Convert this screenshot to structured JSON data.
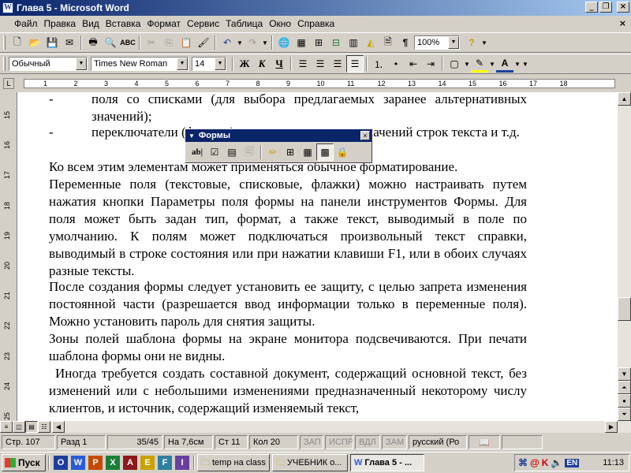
{
  "window": {
    "title": "Глава 5 - Microsoft Word",
    "app_icon": "W"
  },
  "menu": [
    "Файл",
    "Правка",
    "Вид",
    "Вставка",
    "Формат",
    "Сервис",
    "Таблица",
    "Окно",
    "Справка"
  ],
  "standard_toolbar": {
    "zoom": "100%",
    "icons": [
      "new-document-icon",
      "open-icon",
      "save-icon",
      "email-icon",
      "print-icon",
      "print-preview-icon",
      "spelling-icon",
      "cut-icon",
      "copy-icon",
      "paste-icon",
      "format-painter-icon",
      "undo-icon",
      "redo-icon",
      "hyperlink-icon",
      "tables-borders-icon",
      "insert-table-icon",
      "insert-excel-icon",
      "columns-icon",
      "drawing-icon",
      "document-map-icon",
      "show-formatting-icon",
      "help-icon"
    ]
  },
  "formatting_toolbar": {
    "style": "Обычный",
    "font": "Times New Roman",
    "size": "14",
    "bold": "Ж",
    "italic": "К",
    "underline": "Ч"
  },
  "ruler": {
    "numbers": [
      "1",
      "2",
      "3",
      "4",
      "5",
      "6",
      "7",
      "8",
      "9",
      "10",
      "11",
      "12",
      "13",
      "14",
      "15",
      "16",
      "17",
      "18"
    ]
  },
  "vertical_ruler": [
    "15",
    "16",
    "17",
    "18",
    "19",
    "20",
    "21",
    "22",
    "23",
    "24",
    "25"
  ],
  "document": {
    "bullet": "-",
    "paragraphs": [
      "поля со списками (для выбора предлагаемых заранее альтернативных значений);",
      "переключатели (флажки) для пометки нужных значений строк текста и т.д.",
      "Ко всем этим элементам может применяться обычное форматирование.",
      "Переменные поля (текстовые, списковые, флажки) можно настраивать путем нажатия кнопки Параметры поля формы на панели инструментов Формы. Для поля может быть задан тип, формат,  а также текст, выводимый в поле по умолчанию. К полям может подключаться произвольный текст справки, выводимый в строке состояния или при нажатии клавиши F1, или в обоих случаях разные тексты.",
      "После создания формы следует установить ее защиту, с целью запрета изменения постоянной части (разрешается ввод информации только в переменные поля). Можно установить пароль для снятия защиты.",
      "Зоны полей шаблона формы на экране монитора подсвечиваются. При печати шаблона формы они не видны.",
      "Иногда требуется создать составной документ, содержащий основной текст, без изменений или с небольшими изменениями предназначенный некоторому числу клиентов, и источник, содержащий изменяемый текст,"
    ]
  },
  "forms_toolbar": {
    "title": "Формы",
    "close": "×"
  },
  "status": {
    "page": "Стр. 107",
    "section": "Разд 1",
    "pages": "35/45",
    "at": "На 7,6см",
    "line": "Ст 11",
    "col": "Кол 20",
    "rec": "ЗАП",
    "trk": "ИСПР",
    "ext": "ВДЛ",
    "ovr": "ЗАМ",
    "lang": "русский (Ро"
  },
  "taskbar": {
    "start": "Пуск",
    "tasks": [
      "temp на class",
      "УЧЕБНИК о...",
      "Глава 5 - ..."
    ],
    "lang": "EN",
    "clock": "11:13"
  }
}
